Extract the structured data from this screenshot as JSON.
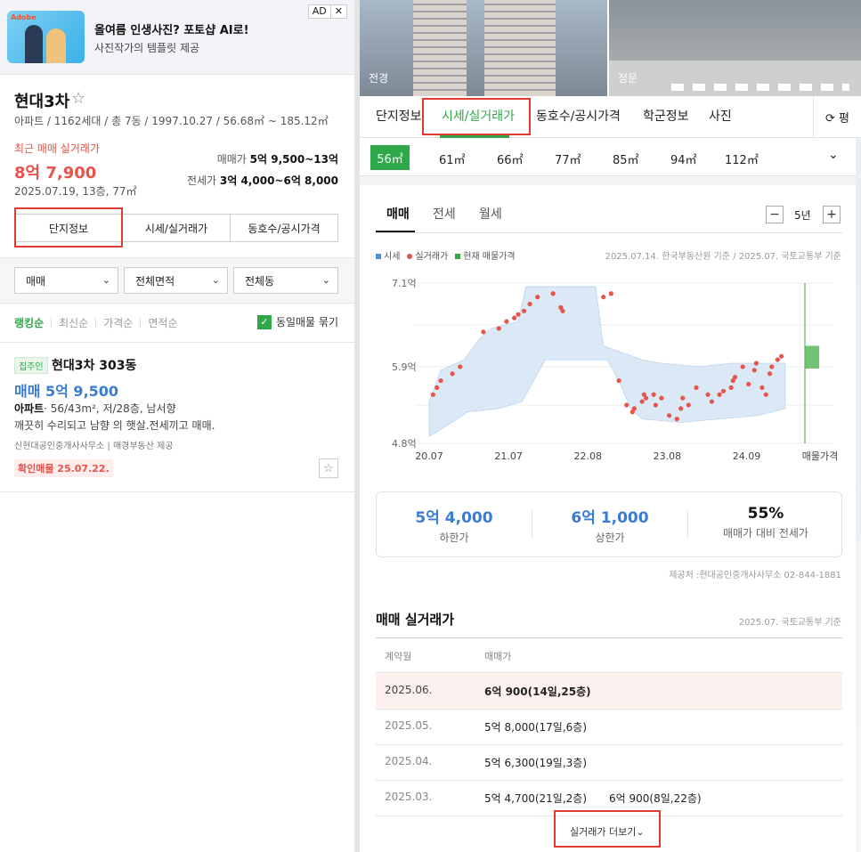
{
  "ad": {
    "logo": "Adobe",
    "headline": "올여름 인생사진? 포토샵 AI로!",
    "sub": "사진작가의 템플릿 제공",
    "badge": "AD",
    "close": "✕"
  },
  "complex": {
    "name": "현대3차",
    "summary": "아파트 / 1162세대 / 총 7동 / 1997.10.27 / 56.68㎡ ~ 185.12㎡",
    "recent_label": "최근 매매 실거래가",
    "recent_price": "8억 7,900",
    "recent_detail": "2025.07.19, 13층, 77㎡",
    "sale_label": "매매가",
    "sale_range": "5억 9,500~13억",
    "jeonse_label": "전세가",
    "jeonse_range": "3억 4,000~6억 8,000"
  },
  "left_buttons": [
    "단지정보",
    "시세/실거래가",
    "동호수/공시가격"
  ],
  "filters": {
    "trade": "매매",
    "area": "전체면적",
    "dong": "전체동"
  },
  "sort": {
    "options": [
      "랭킹순",
      "최신순",
      "가격순",
      "면적순"
    ],
    "bundle_label": "동일매물 묶기"
  },
  "listing": {
    "tag": "집주인",
    "title": "현대3차 303동",
    "price": "매매 5억 9,500",
    "type": "아파트",
    "spec": "· 56/43m², 저/28층, 남서향",
    "desc": "깨끗히 수리되고 남향 의 햇살.전세끼고 매매.",
    "agent": "신현대공인중개사사무소",
    "provider": "매경부동산 제공",
    "confirmed": "확인매물 25.07.22."
  },
  "photos": {
    "left_label": "전경",
    "right_label": "정문"
  },
  "tabs": [
    "단지정보",
    "시세/실거래가",
    "동호수/공시가격",
    "학군정보",
    "사진"
  ],
  "unit_toggle": "⟳ 평",
  "sizes": [
    "56㎡",
    "61㎡",
    "66㎡",
    "77㎡",
    "85㎡",
    "94㎡",
    "112㎡"
  ],
  "deal_tabs": [
    "매매",
    "전세",
    "월세"
  ],
  "period": {
    "minus": "−",
    "value": "5년",
    "plus": "+"
  },
  "legend": {
    "market": "시세",
    "actual": "실거래가",
    "listing": "현재 매물가격",
    "source": "2025.07.14. 한국부동산원 기준 / 2025.07. 국토교통부 기준"
  },
  "colors": {
    "accent": "#2ea848",
    "actual_dot": "#e6544b",
    "market_band": "#dbe9f7",
    "blue_text": "#3a7bd5"
  },
  "chart_data": {
    "type": "scatter",
    "y_ticks": [
      "7.1억",
      "5.9억",
      "4.8억"
    ],
    "ylim": [
      4.8,
      7.1
    ],
    "x_ticks": [
      "20.07",
      "21.07",
      "22.08",
      "23.08",
      "24.09",
      "매물가격"
    ],
    "series": [
      {
        "name": "실거래가",
        "x": [
          0.1,
          0.2,
          0.3,
          0.6,
          0.8,
          1.4,
          1.8,
          2.0,
          2.2,
          2.3,
          2.45,
          2.6,
          2.8,
          3.2,
          3.4,
          3.45,
          4.5,
          4.7,
          4.9,
          5.1,
          5.25,
          5.3,
          5.5,
          5.55,
          5.6,
          5.8,
          5.85,
          6.0,
          6.2,
          6.4,
          6.5,
          6.55,
          6.7,
          6.9,
          7.2,
          7.3,
          7.5,
          7.6,
          7.8,
          7.85,
          7.9,
          8.1,
          8.25,
          8.4,
          8.45,
          8.6,
          8.7,
          8.8,
          8.85,
          9.0,
          9.1
        ],
        "y": [
          5.5,
          5.6,
          5.7,
          5.8,
          5.9,
          6.4,
          6.45,
          6.55,
          6.6,
          6.65,
          6.7,
          6.8,
          6.9,
          6.95,
          6.75,
          6.7,
          6.9,
          6.95,
          5.7,
          5.35,
          5.25,
          5.3,
          5.4,
          5.5,
          5.45,
          5.5,
          5.35,
          5.45,
          5.2,
          5.15,
          5.3,
          5.45,
          5.35,
          5.6,
          5.5,
          5.4,
          5.5,
          5.55,
          5.6,
          5.7,
          5.75,
          5.9,
          5.65,
          5.85,
          5.95,
          5.6,
          5.5,
          5.8,
          5.9,
          6.0,
          6.05
        ]
      }
    ]
  },
  "stats": [
    {
      "value": "5억 4,000",
      "label": "하한가"
    },
    {
      "value": "6억 1,000",
      "label": "상한가"
    },
    {
      "value": "55%",
      "label": "매매가 대비 전세가"
    }
  ],
  "provider_note": "제공처 :현대공인중개사사무소 02-844-1881",
  "transactions": {
    "title": "매매 실거래가",
    "source": "2025.07. 국토교통부 기준",
    "col_month": "계약월",
    "col_price": "매매가",
    "rows": [
      {
        "month": "2025.06.",
        "price": "6억 900(14일,25층)",
        "price2": ""
      },
      {
        "month": "2025.05.",
        "price": "5억 8,000(17일,6층)",
        "price2": ""
      },
      {
        "month": "2025.04.",
        "price": "5억 6,300(19일,3층)",
        "price2": ""
      },
      {
        "month": "2025.03.",
        "price": "5억 4,700(21일,2층)",
        "price2": "6억 900(8일,22층)"
      }
    ],
    "more": "실거래가 더보기⌄"
  }
}
